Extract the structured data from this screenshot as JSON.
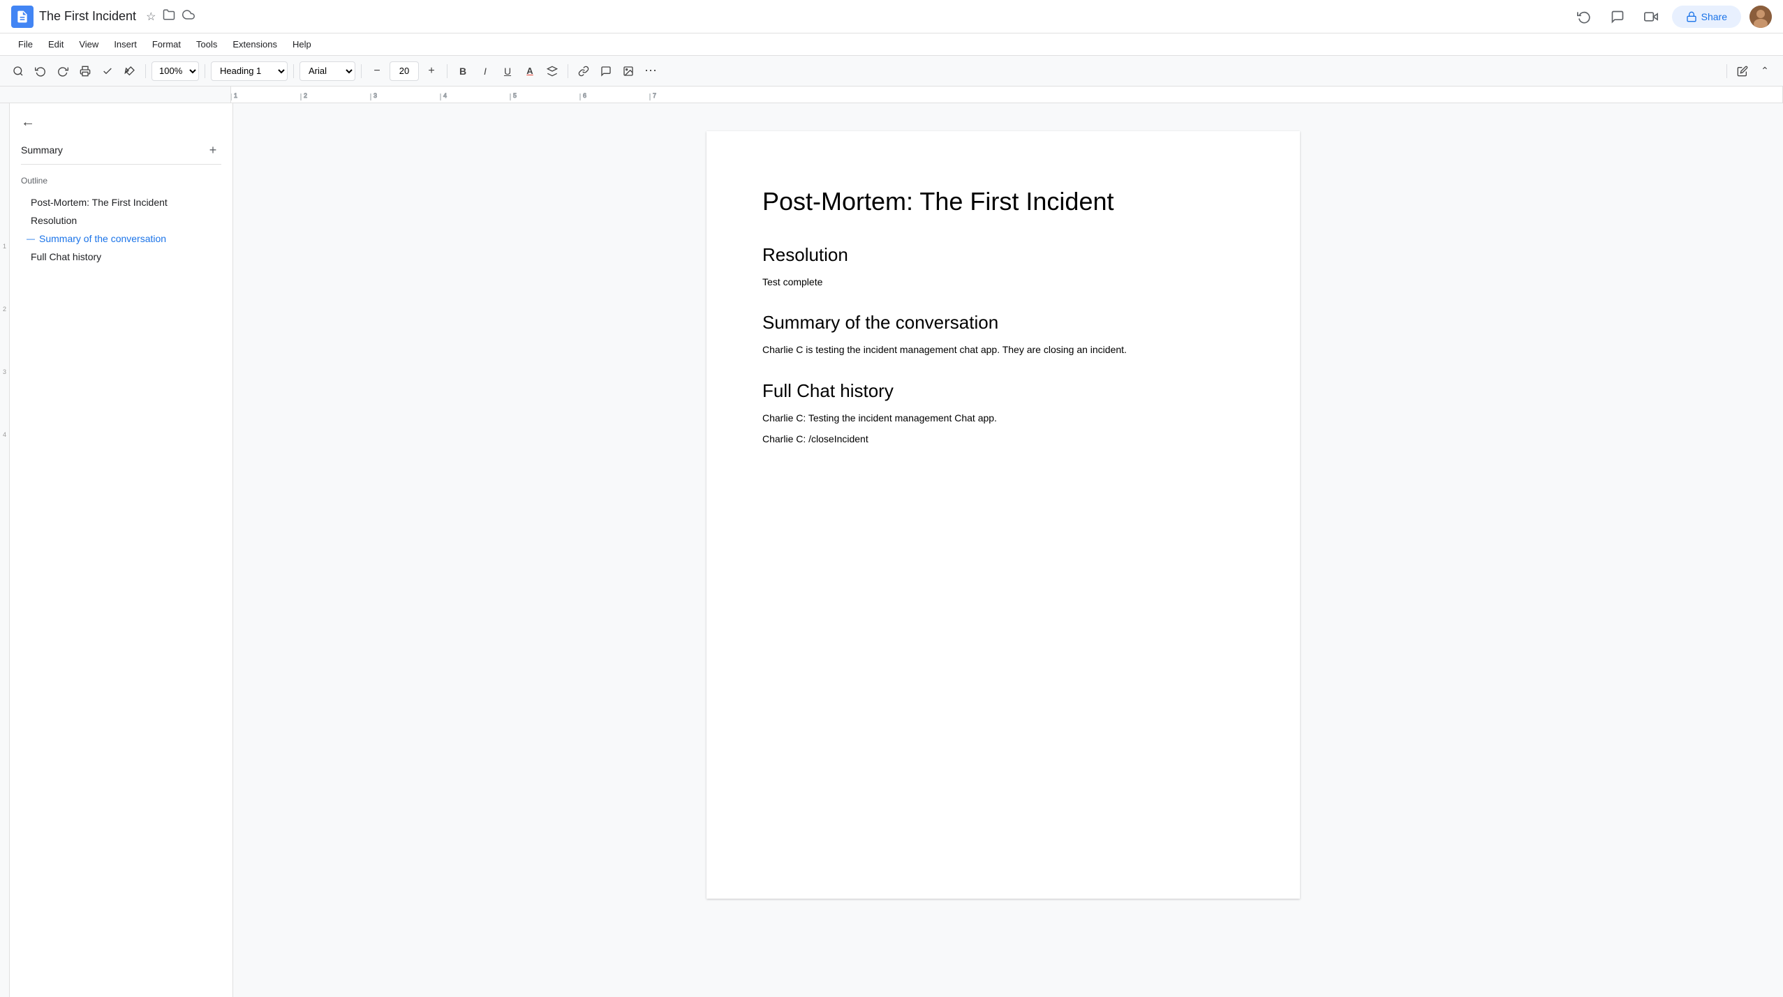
{
  "app": {
    "title": "The First Incident",
    "doc_icon_label": "Google Docs icon"
  },
  "title_bar": {
    "doc_title": "The First Incident",
    "star_icon": "☆",
    "folder_icon": "📁",
    "cloud_icon": "☁",
    "share_label": "Share"
  },
  "menu": {
    "items": [
      "File",
      "Edit",
      "View",
      "Insert",
      "Format",
      "Tools",
      "Extensions",
      "Help"
    ]
  },
  "toolbar": {
    "search_icon": "🔍",
    "undo_icon": "↩",
    "redo_icon": "↪",
    "print_icon": "🖨",
    "spell_icon": "✓",
    "paint_icon": "🖌",
    "zoom_value": "100%",
    "style_value": "Heading 1",
    "font_value": "Arial",
    "font_size": "20",
    "bold_label": "B",
    "italic_label": "I",
    "underline_label": "U",
    "text_color_icon": "A",
    "highlight_icon": "◈",
    "link_icon": "🔗",
    "comment_icon": "💬",
    "image_icon": "🖼",
    "more_icon": "⋯",
    "edit_icon": "✏",
    "collapse_icon": "⌃"
  },
  "sidebar": {
    "back_icon": "←",
    "summary_label": "Summary",
    "add_icon": "+",
    "outline_label": "Outline",
    "outline_items": [
      {
        "text": "Post-Mortem: The First Incident",
        "active": false
      },
      {
        "text": "Resolution",
        "active": false
      },
      {
        "text": "Summary of the conversation",
        "active": true
      },
      {
        "text": "Full Chat history",
        "active": false
      }
    ]
  },
  "document": {
    "main_title": "Post-Mortem: The First Incident",
    "sections": [
      {
        "heading": "Resolution",
        "body_lines": [
          "Test complete"
        ]
      },
      {
        "heading": "Summary of the conversation",
        "body_lines": [
          "Charlie C is testing the incident management chat app. They are closing an incident."
        ]
      },
      {
        "heading": "Full Chat history",
        "body_lines": [
          "Charlie C: Testing the incident management Chat app.",
          "Charlie C: /closeIncident"
        ]
      }
    ]
  },
  "colors": {
    "active_outline": "#1a73e8",
    "doc_bg": "#f8f9fa",
    "page_bg": "#ffffff",
    "text_primary": "#202124",
    "text_secondary": "#5f6368",
    "border": "#e0e0e0",
    "share_bg": "#e8f0fe",
    "share_text": "#1a73e8"
  }
}
